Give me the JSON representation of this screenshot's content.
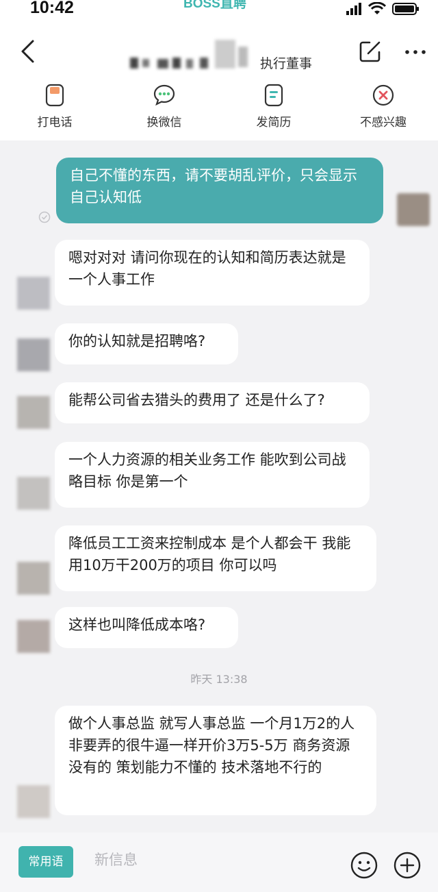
{
  "status_bar": {
    "time": "10:42",
    "app_brand": "BOSS直聘"
  },
  "header": {
    "contact_role": "执行董事"
  },
  "actions": [
    {
      "label": "打电话",
      "icon": "phone-icon"
    },
    {
      "label": "换微信",
      "icon": "wechat-icon"
    },
    {
      "label": "发简历",
      "icon": "resume-icon"
    },
    {
      "label": "不感兴趣",
      "icon": "not-interested-icon"
    }
  ],
  "messages": [
    {
      "from": "me",
      "text": "自己不懂的东西，请不要胡乱评价，只会显示自己认知低"
    },
    {
      "from": "them",
      "text": "嗯对对对 请问你现在的认知和简历表达就是一个人事工作"
    },
    {
      "from": "them",
      "text": "你的认知就是招聘咯?"
    },
    {
      "from": "them",
      "text": "能帮公司省去猎头的费用了 还是什么了?"
    },
    {
      "from": "them",
      "text": "一个人力资源的相关业务工作 能吹到公司战略目标 你是第一个"
    },
    {
      "from": "them",
      "text": "降低员工工资来控制成本 是个人都会干 我能用10万干200万的项目 你可以吗"
    },
    {
      "from": "them",
      "text": "这样也叫降低成本咯?"
    },
    {
      "from": "them",
      "text": "做个人事总监 就写人事总监 一个月1万2的人 非要弄的很牛逼一样开价3万5-5万 商务资源没有的 策划能力不懂的 技术落地不行的"
    }
  ],
  "timestamp": "昨天 13:38",
  "composer": {
    "quick_phrases": "常用语",
    "placeholder": "新信息"
  },
  "colors": {
    "accent": "#40b3ae",
    "my_bubble": "#4aabad",
    "chat_background": "#f2f2f4"
  }
}
